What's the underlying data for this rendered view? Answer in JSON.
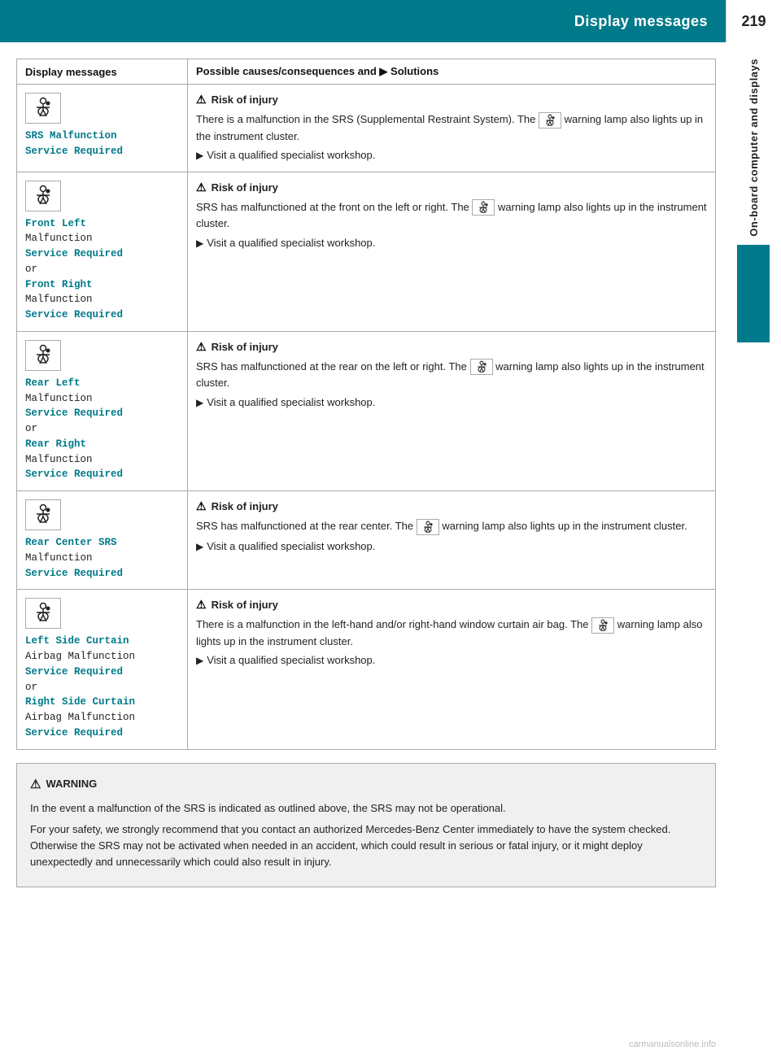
{
  "header": {
    "title": "Display messages",
    "page_number": "219"
  },
  "side_tab": {
    "label": "On-board computer and displays"
  },
  "table": {
    "col1_header": "Display messages",
    "col2_header": "Possible causes/consequences and ▶ Solutions",
    "rows": [
      {
        "id": "row1",
        "label_lines": [
          {
            "text": "SRS Malfunction",
            "class": "highlight"
          },
          {
            "text": "Service Required",
            "class": "highlight"
          }
        ],
        "risk_title": "Risk of injury",
        "description": "There is a malfunction in the SRS (Supplemental Restraint System). The warning lamp also lights up in the instrument cluster.",
        "solution": "Visit a qualified specialist workshop."
      },
      {
        "id": "row2",
        "label_lines": [
          {
            "text": "Front Left",
            "class": "highlight"
          },
          {
            "text": "Malfunction",
            "class": "normal"
          },
          {
            "text": "Service Required",
            "class": "highlight"
          },
          {
            "text": "or",
            "class": "normal"
          },
          {
            "text": "Front Right",
            "class": "highlight"
          },
          {
            "text": "Malfunction",
            "class": "normal"
          },
          {
            "text": "Service Required",
            "class": "highlight"
          }
        ],
        "risk_title": "Risk of injury",
        "description": "SRS has malfunctioned at the front on the left or right. The warning lamp also lights up in the instrument cluster.",
        "solution": "Visit a qualified specialist workshop."
      },
      {
        "id": "row3",
        "label_lines": [
          {
            "text": "Rear Left",
            "class": "highlight"
          },
          {
            "text": "Malfunction",
            "class": "normal"
          },
          {
            "text": "Service Required",
            "class": "highlight"
          },
          {
            "text": "or",
            "class": "normal"
          },
          {
            "text": "Rear Right",
            "class": "highlight"
          },
          {
            "text": "Malfunction",
            "class": "normal"
          },
          {
            "text": "Service Required",
            "class": "highlight"
          }
        ],
        "risk_title": "Risk of injury",
        "description": "SRS has malfunctioned at the rear on the left or right. The warning lamp also lights up in the instrument cluster.",
        "solution": "Visit a qualified specialist workshop."
      },
      {
        "id": "row4",
        "label_lines": [
          {
            "text": "Rear Center SRS",
            "class": "highlight"
          },
          {
            "text": "Malfunction",
            "class": "normal"
          },
          {
            "text": "Service Required",
            "class": "highlight"
          }
        ],
        "risk_title": "Risk of injury",
        "description": "SRS has malfunctioned at the rear center. The warning lamp also lights up in the instrument cluster.",
        "solution": "Visit a qualified specialist workshop."
      },
      {
        "id": "row5",
        "label_lines": [
          {
            "text": "Left Side Curtain",
            "class": "highlight"
          },
          {
            "text": "Airbag Malfunction",
            "class": "normal"
          },
          {
            "text": "Service Required",
            "class": "highlight"
          },
          {
            "text": "or",
            "class": "normal"
          },
          {
            "text": "Right Side Curtain",
            "class": "highlight"
          },
          {
            "text": "Airbag Malfunction",
            "class": "normal"
          },
          {
            "text": "Service Required",
            "class": "highlight"
          }
        ],
        "risk_title": "Risk of injury",
        "description": "There is a malfunction in the left-hand and/or right-hand window curtain air bag. The warning lamp also lights up in the instrument cluster.",
        "solution": "Visit a qualified specialist workshop."
      }
    ]
  },
  "warning_box": {
    "title": "WARNING",
    "para1": "In the event a malfunction of the SRS is indicated as outlined above, the SRS may not be operational.",
    "para2": "For your safety, we strongly recommend that you contact an authorized Mercedes-Benz Center immediately to have the system checked. Otherwise the SRS may not be activated when needed in an accident, which could result in serious or fatal injury, or it might deploy unexpectedly and unnecessarily which could also result in injury."
  },
  "watermark": "carmanualsonline.info"
}
